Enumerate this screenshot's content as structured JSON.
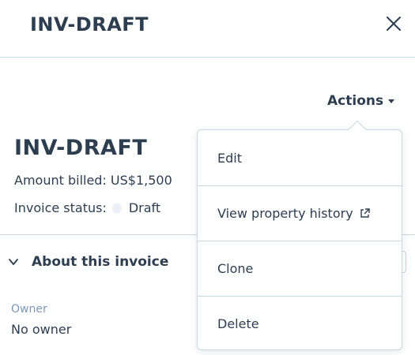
{
  "header": {
    "title": "INV-DRAFT",
    "close_icon": "close-icon"
  },
  "actions": {
    "label": "Actions",
    "icon": "caret-down-icon",
    "menu": [
      {
        "label": "Edit"
      },
      {
        "label": "View property history",
        "icon": "external-link-icon"
      },
      {
        "label": "Clone"
      },
      {
        "label": "Delete"
      }
    ]
  },
  "record": {
    "title": "INV-DRAFT",
    "amount_line": "Amount billed: US$1,500",
    "status_label": "Invoice status:",
    "status_value": "Draft"
  },
  "section": {
    "label": "About this invoice",
    "icon": "chevron-down-icon"
  },
  "owner": {
    "label": "Owner",
    "value": "No owner"
  },
  "colors": {
    "text": "#2d3e50",
    "muted": "#7c98b6",
    "border": "#cbd6e2",
    "status_dot": "#eaf0f6"
  }
}
